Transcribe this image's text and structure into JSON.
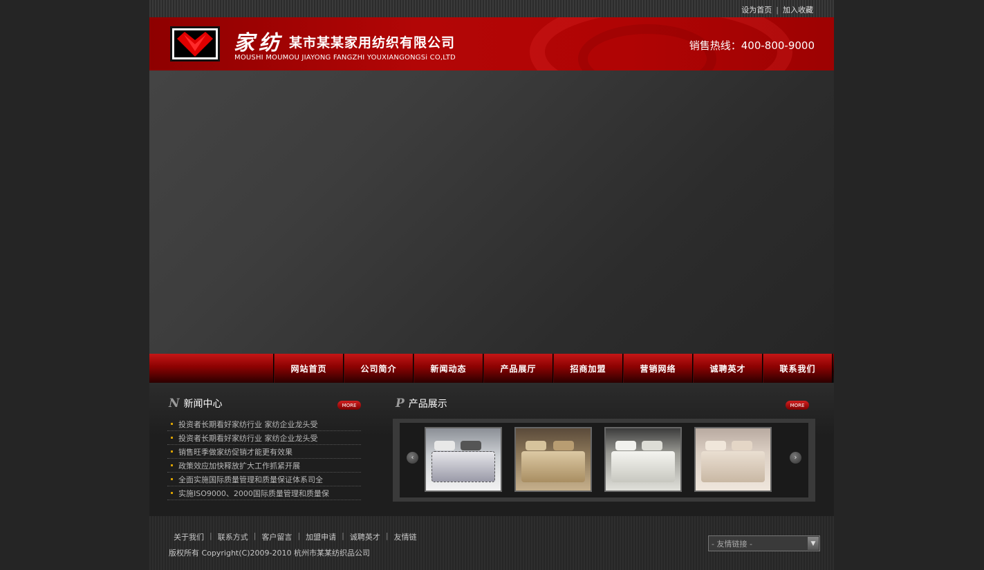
{
  "toplinks": {
    "home": "设为首页",
    "separator": "|",
    "favorite": "加入收藏"
  },
  "header": {
    "brand_cn": "家纺",
    "company": "某市某某家用纺织有限公司",
    "company_en": "MOUSHI MOUMOU JIAYONG FANGZHI YOUXIANGONGSi CO,LTD",
    "hotline": "销售热线：400-800-9000"
  },
  "nav": [
    {
      "label": "网站首页"
    },
    {
      "label": "公司简介"
    },
    {
      "label": "新闻动态"
    },
    {
      "label": "产品展厅"
    },
    {
      "label": "招商加盟"
    },
    {
      "label": "营销网络"
    },
    {
      "label": "诚聘英才"
    },
    {
      "label": "联系我们"
    }
  ],
  "news": {
    "letter": "N",
    "title": "新闻中心",
    "more": "MORE",
    "items": [
      "投资者长期看好家纺行业 家纺企业龙头受",
      "投资者长期看好家纺行业 家纺企业龙头受",
      "销售旺季做家纺促销才能更有效果",
      "政策效应加快释放扩大工作抓紧开展",
      "全面实施国际质量管理和质量保证体系司全",
      "实施ISO9000、2000国际质量管理和质量保"
    ]
  },
  "products": {
    "letter": "P",
    "title": "产品展示",
    "more": "MORE",
    "prev": "‹",
    "next": "›"
  },
  "footer": {
    "links": [
      "关于我们",
      "联系方式",
      "客户留言",
      "加盟申请",
      "诚聘英才",
      "友情链"
    ],
    "separator": "|",
    "copyright": "版权所有 Copyright(C)2009-2010 杭州市某某纺织品公司",
    "friend_select": "- 友情链接 -"
  }
}
